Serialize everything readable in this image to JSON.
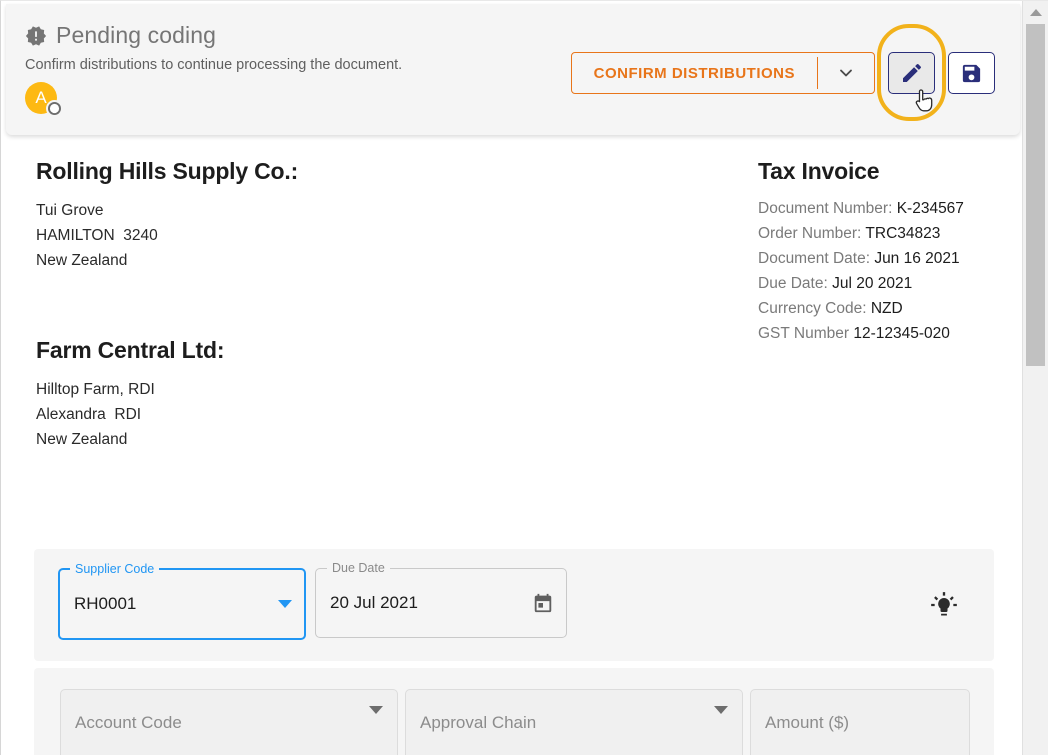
{
  "status_card": {
    "icon": "alert-badge-icon",
    "title": "Pending coding",
    "subtitle": "Confirm distributions to continue processing the document.",
    "avatar_initial": "A",
    "avatar_color": "#FDB913",
    "avatar_badge_icon": "clock-icon"
  },
  "actions": {
    "confirm_label": "CONFIRM DISTRIBUTIONS",
    "confirm_color": "#E8751A",
    "dropdown_icon": "chevron-down-icon",
    "edit_icon": "pencil-icon",
    "save_icon": "floppy-disk-icon",
    "icon_button_color": "#2A2E7A",
    "highlight_color": "#F2B21B",
    "cursor_icon": "pointing-hand-cursor"
  },
  "document": {
    "supplier": {
      "name": "Rolling Hills Supply Co.:",
      "lines": [
        "Tui Grove",
        "HAMILTON  3240",
        "New Zealand"
      ]
    },
    "customer": {
      "name": "Farm Central Ltd:",
      "lines": [
        "Hilltop Farm, RDI",
        "Alexandra  RDI",
        "New Zealand"
      ]
    },
    "invoice": {
      "title": "Tax Invoice",
      "fields": [
        {
          "label": "Document Number:",
          "value": "K-234567"
        },
        {
          "label": "Order Number:",
          "value": "TRC34823"
        },
        {
          "label": "Document Date:",
          "value": "Jun 16 2021"
        },
        {
          "label": "Due Date:",
          "value": "Jul 20 2021"
        },
        {
          "label": "Currency Code:",
          "value": "NZD"
        },
        {
          "label": "GST Number",
          "value": "12-12345-020"
        }
      ]
    }
  },
  "form": {
    "supplier_code": {
      "label": "Supplier Code",
      "value": "RH0001",
      "focused": true,
      "trailing_icon": "chevron-down-icon"
    },
    "due_date": {
      "label": "Due Date",
      "value": "20 Jul 2021",
      "trailing_icon": "calendar-icon"
    },
    "hint_icon": "lightbulb-icon",
    "account_code": {
      "placeholder": "Account Code",
      "value": "",
      "trailing_icon": "chevron-down-icon"
    },
    "approval_chain": {
      "placeholder": "Approval Chain",
      "value": "",
      "trailing_icon": "chevron-down-icon"
    },
    "amount": {
      "placeholder": "Amount ($)",
      "value": ""
    }
  },
  "scrollbar": {
    "up_arrow_icon": "triangle-up-icon"
  }
}
